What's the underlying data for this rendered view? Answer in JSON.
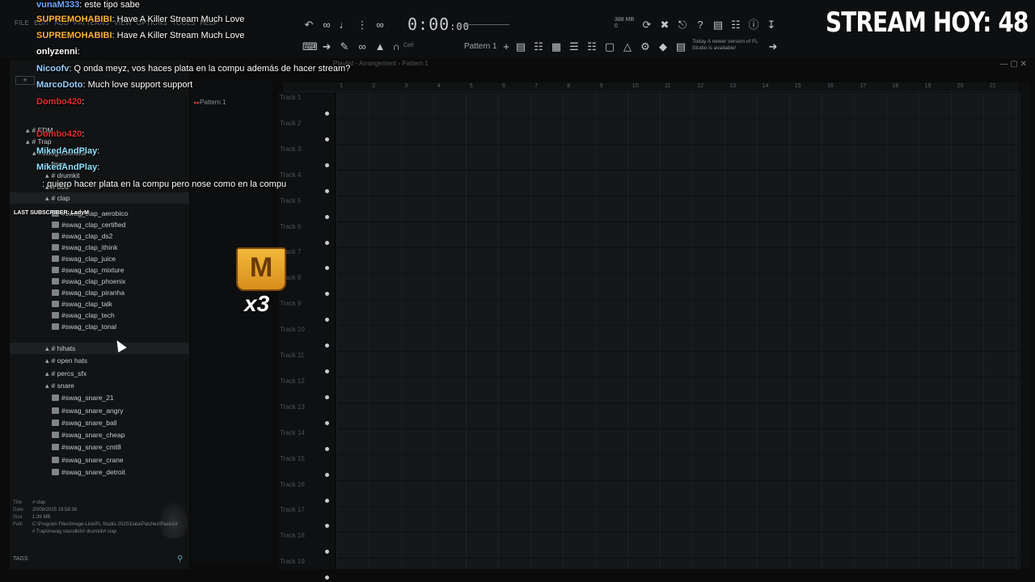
{
  "toolbar": {
    "menu": [
      "FILE",
      "EDIT",
      "ADD",
      "PATTERNS",
      "VIEW",
      "OPTIONS",
      "TOOLS",
      "HELP"
    ],
    "time": "0:00",
    "time_ms": ":00",
    "memory": "388 MB",
    "memory_sub": "0",
    "pattern": "Pattern 1",
    "hint": "Cell",
    "news_title": "Today",
    "news_body": "A newer version of FL Studio is available!"
  },
  "stream": {
    "counter": "STREAM HOY: 48"
  },
  "playlist": {
    "title": "Playlist - Arrangement › Pattern 1",
    "ruler": [
      "1",
      "2",
      "3",
      "4",
      "5",
      "6",
      "7",
      "8",
      "9",
      "10",
      "11",
      "12",
      "13",
      "14",
      "15",
      "16",
      "17",
      "18",
      "19",
      "20",
      "21"
    ],
    "tracks": [
      "Track 1",
      "Track 2",
      "Track 3",
      "Track 4",
      "Track 5",
      "Track 6",
      "Track 7",
      "Track 8",
      "Track 9",
      "Track 10",
      "Track 11",
      "Track 12",
      "Track 13",
      "Track 14",
      "Track 15",
      "Track 16",
      "Track 17",
      "Track 18",
      "Track 19"
    ]
  },
  "picker": {
    "pattern": "Pattern 1"
  },
  "browser": {
    "tree": [
      {
        "label": "# EDM",
        "kind": "folder",
        "indent": 20
      },
      {
        "label": "# Trap",
        "kind": "folder",
        "indent": 20
      },
      {
        "label": "#swag soundkit",
        "kind": "folder",
        "indent": 28
      },
      {
        "label": "fmgs",
        "kind": "folder",
        "indent": 44
      },
      {
        "label": "# drumkit",
        "kind": "folder",
        "indent": 44
      },
      {
        "label": "# 808",
        "kind": "folder",
        "indent": 44
      },
      {
        "label": "# clap",
        "kind": "folder",
        "indent": 44,
        "selected": true
      },
      {
        "label": "#swag_clap_aerobico",
        "kind": "file",
        "indent": 52
      },
      {
        "label": "#swag_clap_certified",
        "kind": "file",
        "indent": 52
      },
      {
        "label": "#swag_clap_ds2",
        "kind": "file",
        "indent": 52
      },
      {
        "label": "#swag_clap_ithink",
        "kind": "file",
        "indent": 52
      },
      {
        "label": "#swag_clap_juice",
        "kind": "file",
        "indent": 52
      },
      {
        "label": "#swag_clap_mixture",
        "kind": "file",
        "indent": 52
      },
      {
        "label": "#swag_clap_phoenix",
        "kind": "file",
        "indent": 52
      },
      {
        "label": "#swag_clap_piranha",
        "kind": "file",
        "indent": 52
      },
      {
        "label": "#swag_clap_talk",
        "kind": "file",
        "indent": 52
      },
      {
        "label": "#swag_clap_tech",
        "kind": "file",
        "indent": 52
      },
      {
        "label": "#swag_clap_tonal",
        "kind": "file",
        "indent": 52
      },
      {
        "label": "# hihats",
        "kind": "folder",
        "indent": 44,
        "selected": true
      },
      {
        "label": "# open hats",
        "kind": "folder",
        "indent": 44
      },
      {
        "label": "# percs_sfx",
        "kind": "folder",
        "indent": 44
      },
      {
        "label": "# snare",
        "kind": "folder",
        "indent": 44
      },
      {
        "label": "#swag_snare_21",
        "kind": "file",
        "indent": 52
      },
      {
        "label": "#swag_snare_angry",
        "kind": "file",
        "indent": 52
      },
      {
        "label": "#swag_snare_ball",
        "kind": "file",
        "indent": 52
      },
      {
        "label": "#swag_snare_cheap",
        "kind": "file",
        "indent": 52
      },
      {
        "label": "#swag_snare_cmt8",
        "kind": "file",
        "indent": 52
      },
      {
        "label": "#swag_snare_crane",
        "kind": "file",
        "indent": 52
      },
      {
        "label": "#swag_snare_detroit",
        "kind": "file",
        "indent": 52
      }
    ],
    "info": {
      "title_key": "Title",
      "title_val": "# clap",
      "date_key": "Date",
      "date_val": "20/09/2025 19:58:38",
      "size_key": "Size",
      "size_val": "1.36 MB",
      "path_key": "Path",
      "path_val": "C:\\Program Files\\Image-Line\\FL Studio 2025\\Data\\Patches\\Packs\\## Trap\\#swag soundkit\\# drumkit\\# clap"
    },
    "tags_label": "TAGS"
  },
  "chat": [
    {
      "user": "vunaM333",
      "color": "#6fa8ff",
      "text": ": este tipo sabe"
    },
    {
      "user": "SUPREMOHABIBI",
      "color": "#ffb43a",
      "text": ": Have A Killer Stream Much Love"
    },
    {
      "user": "SUPREMOHABIBI",
      "color": "#ffb43a",
      "text": ": Have A Killer Stream Much Love"
    },
    {
      "user": "onlyzenni",
      "color": "#ffffff",
      "text": ":"
    },
    {
      "user": "Nicoofv",
      "color": "#9ad0ff",
      "text": ": Q onda meyz, vos haces plata en la compu además de hacer stream?"
    },
    {
      "user": "MarcoDoto",
      "color": "#9ad0ff",
      "text": ": Much love support support"
    },
    {
      "user": "Dombo420",
      "color": "#e03030",
      "text": ":"
    },
    {
      "user": "Dombo420",
      "color": "#e03030",
      "text": ":"
    },
    {
      "user": "MikedAndPlay",
      "color": "#8fe0ff",
      "text": ":"
    },
    {
      "user": "MikedAndPlay",
      "color": "#8fe0ff",
      "text": ":"
    },
    {
      "user": "",
      "color": "#ffffff",
      "text": ": quiero hacer plata en la compu pero nose como en la compu"
    }
  ],
  "last_sub": "LAST SUBSCRIBER: LadyM",
  "emote": {
    "count": "x3"
  },
  "colors": {
    "accent": "#c44444",
    "background": "#0b0b0b",
    "grid": "#151718"
  }
}
